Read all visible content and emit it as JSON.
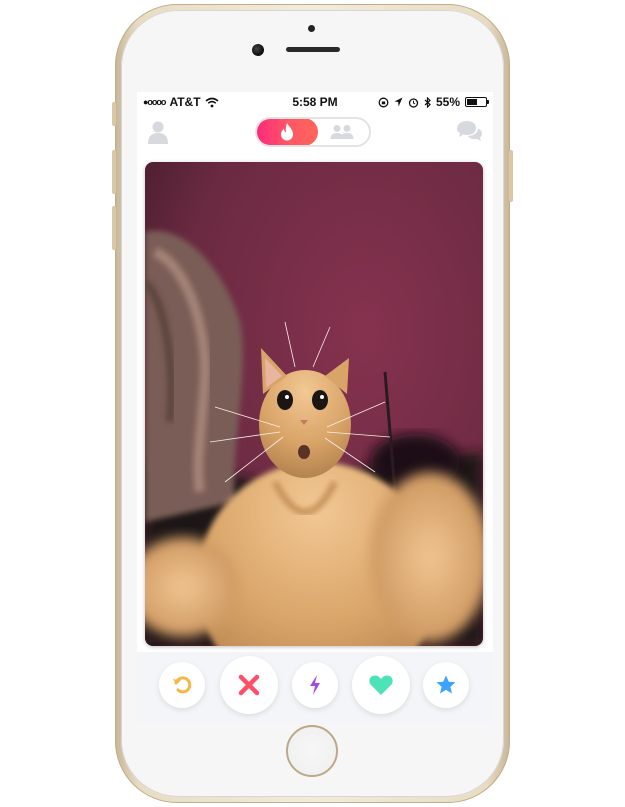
{
  "status_bar": {
    "signal": "●oooo",
    "carrier": "AT&T",
    "time": "5:58 PM",
    "battery_percent_label": "55%",
    "battery_level": 0.55,
    "icons": [
      "wifi-icon",
      "rotation-lock-icon",
      "location-arrow-icon",
      "alarm-icon",
      "bluetooth-icon",
      "battery-icon"
    ]
  },
  "top_nav": {
    "left_icon": "profile-icon",
    "mode_toggle": {
      "active_icon": "flame-icon",
      "inactive_icon": "group-icon",
      "active_index": 0
    },
    "right_icon": "messages-icon"
  },
  "card": {
    "photo": "cat-selfie-photo"
  },
  "action_bar": {
    "buttons": [
      {
        "icon": "rewind-icon",
        "color": "#f5b748"
      },
      {
        "icon": "nope-icon",
        "color": "#fd5068"
      },
      {
        "icon": "boost-icon",
        "color": "#a24ae0"
      },
      {
        "icon": "like-icon",
        "color": "#4ee2b9"
      },
      {
        "icon": "super-like-icon",
        "color": "#3ca4ff"
      }
    ]
  },
  "colors": {
    "brand_gradient_start": "#fd297b",
    "brand_gradient_end": "#ff655b",
    "inactive_icon": "#d6d9de",
    "action_bar_bg": "#f4f5f8"
  }
}
